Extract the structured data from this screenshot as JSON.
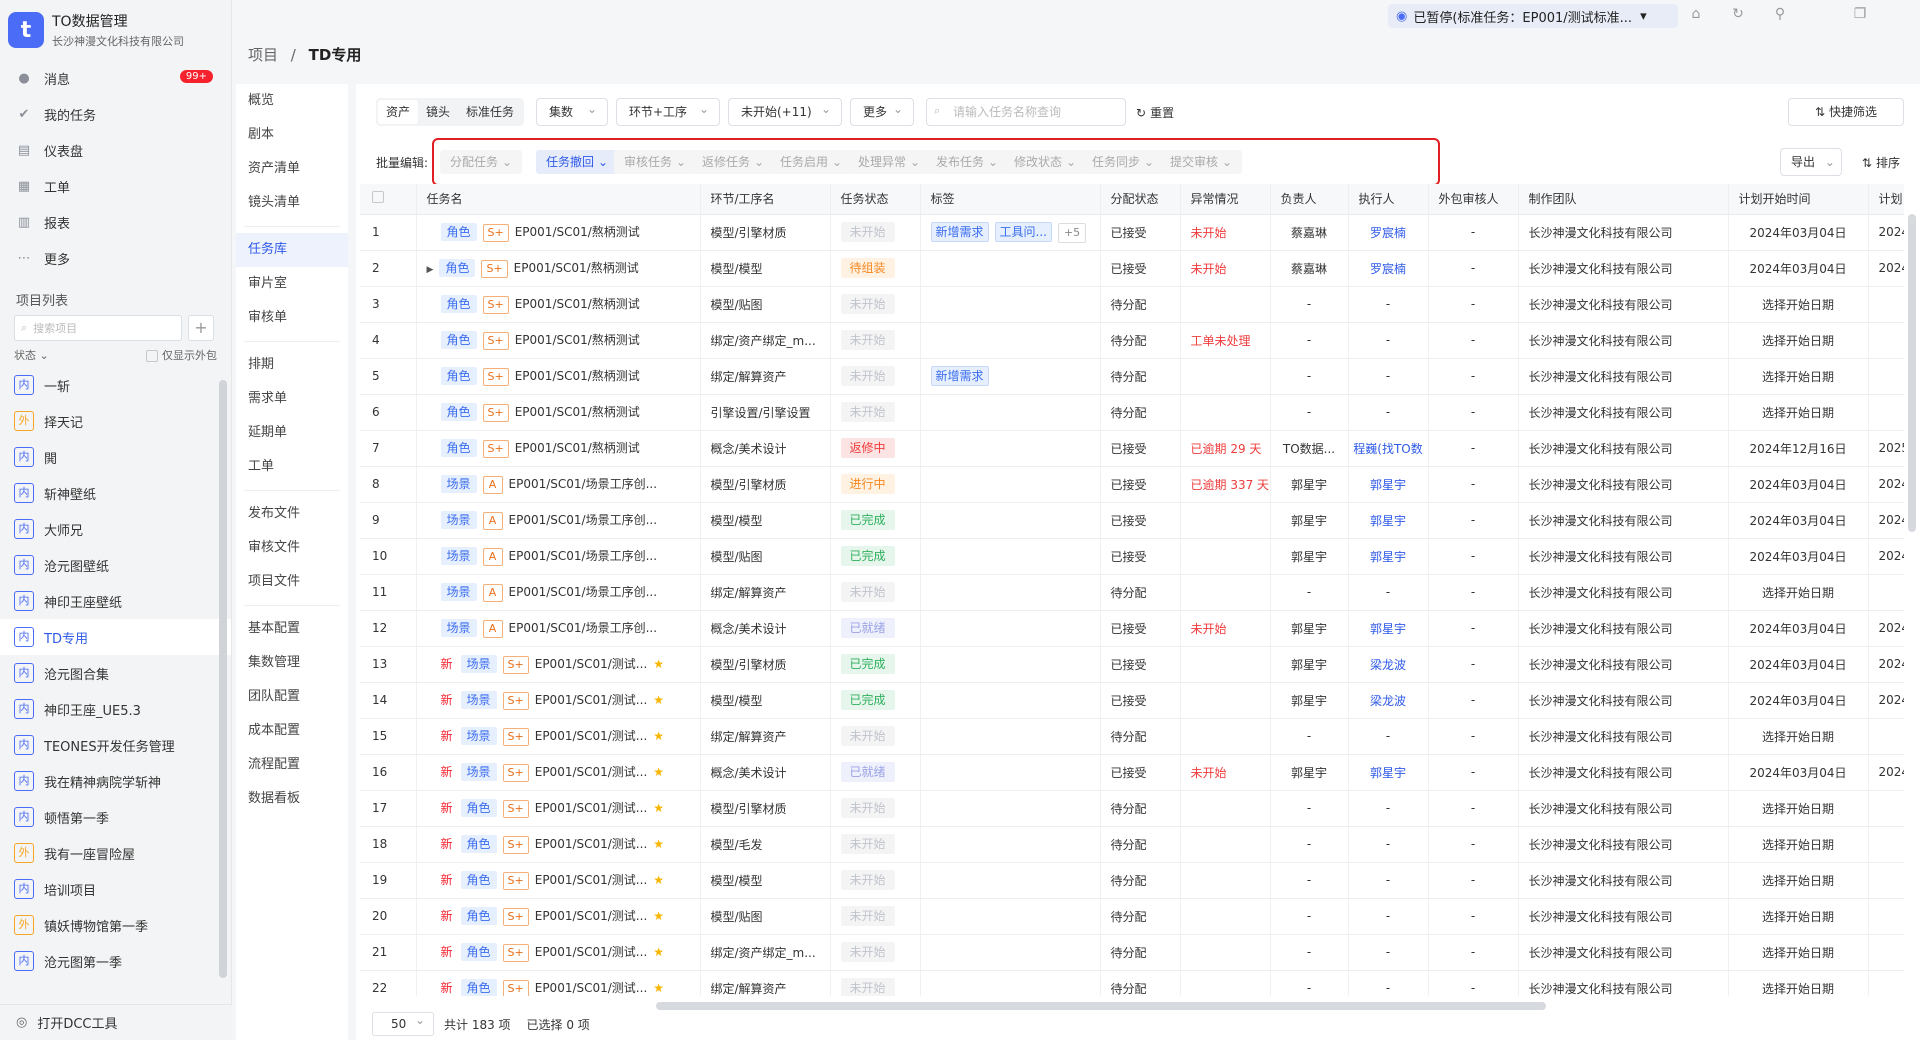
{
  "app": {
    "title": "TO数据管理",
    "company": "长沙神漫文化科技有限公司",
    "logo_letter": "t"
  },
  "nav": [
    {
      "label": "消息",
      "icon": "chat-icon",
      "badge": "99+"
    },
    {
      "label": "我的任务",
      "icon": "check-icon"
    },
    {
      "label": "仪表盘",
      "icon": "dashboard-icon"
    },
    {
      "label": "工单",
      "icon": "ticket-icon"
    },
    {
      "label": "报表",
      "icon": "report-icon"
    },
    {
      "label": "更多",
      "icon": "more-icon"
    }
  ],
  "projects": {
    "heading": "项目列表",
    "search_placeholder": "搜索项目",
    "add_label": "+",
    "filter_label": "状态",
    "only_outsourced_label": "仅显示外包",
    "items": [
      {
        "tag": "内",
        "name": "一斩"
      },
      {
        "tag": "外",
        "name": "择天记"
      },
      {
        "tag": "内",
        "name": "閧"
      },
      {
        "tag": "内",
        "name": "斩神壁纸"
      },
      {
        "tag": "内",
        "name": "大师兄"
      },
      {
        "tag": "内",
        "name": "沧元图壁纸"
      },
      {
        "tag": "内",
        "name": "神印王座壁纸"
      },
      {
        "tag": "内",
        "name": "TD专用"
      },
      {
        "tag": "内",
        "name": "沧元图合集"
      },
      {
        "tag": "内",
        "name": "神印王座_UE5.3"
      },
      {
        "tag": "内",
        "name": "TEONES开发任务管理"
      },
      {
        "tag": "内",
        "name": "我在精神病院学斩神"
      },
      {
        "tag": "内",
        "name": "顿悟第一季"
      },
      {
        "tag": "外",
        "name": "我有一座冒险屋"
      },
      {
        "tag": "内",
        "name": "培训项目"
      },
      {
        "tag": "外",
        "name": "镇妖博物馆第一季"
      },
      {
        "tag": "内",
        "name": "沧元图第一季"
      }
    ],
    "active_index": 7
  },
  "dcc_label": "打开DCC工具",
  "topbar": {
    "paused_text": "已暂停(标准任务：EP001/测试标准...",
    "icons": [
      "camera-icon",
      "refresh-icon",
      "pin-icon",
      "window-icon"
    ]
  },
  "breadcrumb": {
    "root": "项目",
    "sep": "/",
    "current": "TD专用"
  },
  "subnav": {
    "groups": [
      [
        "概览",
        "剧本",
        "资产清单",
        "镜头清单"
      ],
      [
        "任务库",
        "审片室",
        "审核单"
      ],
      [
        "排期",
        "需求单",
        "延期单",
        "工单"
      ],
      [
        "发布文件",
        "审核文件",
        "项目文件"
      ],
      [
        "基本配置",
        "集数管理",
        "团队配置",
        "成本配置",
        "流程配置",
        "数据看板"
      ]
    ],
    "active": "任务库"
  },
  "toolbar": {
    "segments": [
      "资产",
      "镜头",
      "标准任务"
    ],
    "dropdowns": [
      "集数",
      "环节+工序",
      "未开始(+11)",
      "更多"
    ],
    "search_placeholder": "请输入任务名称查询",
    "reset_label": "重置",
    "quick_filter_label": "快捷筛选"
  },
  "batch": {
    "label": "批量编辑:",
    "buttons": [
      "分配任务",
      "任务撤回",
      "审核任务",
      "返修任务",
      "任务启用",
      "处理异常",
      "发布任务",
      "修改状态",
      "任务同步",
      "提交审核"
    ],
    "active_index": 1,
    "export_label": "导出",
    "sort_label": "排序"
  },
  "table": {
    "columns": [
      "任务名",
      "环节/工序名",
      "任务状态",
      "标签",
      "分配状态",
      "异常情况",
      "负责人",
      "执行人",
      "外包审核人",
      "制作团队",
      "计划开始时间",
      "计划"
    ],
    "rows": [
      {
        "idx": "1",
        "new": false,
        "expand": false,
        "kind": "角色",
        "grade": "S+",
        "name": "EP001/SC01/熬柄测试",
        "star": false,
        "step": "模型/引擎材质",
        "status": "未开始",
        "status_color": "gray",
        "labels": [
          "新增需求",
          "工具问..."
        ],
        "more": "+5",
        "assign": "已接受",
        "anomaly": "未开始",
        "owner": "蔡嘉琳",
        "exec": "罗宸楠",
        "reviewer": "-",
        "team": "长沙神漫文化科技有限公司",
        "start": "2024年03月04日",
        "end": "2024"
      },
      {
        "idx": "2",
        "new": false,
        "expand": true,
        "kind": "角色",
        "grade": "S+",
        "name": "EP001/SC01/熬柄测试",
        "star": false,
        "step": "模型/模型",
        "status": "待组装",
        "status_color": "orange",
        "labels": [],
        "more": "",
        "assign": "已接受",
        "anomaly": "未开始",
        "owner": "蔡嘉琳",
        "exec": "罗宸楠",
        "reviewer": "-",
        "team": "长沙神漫文化科技有限公司",
        "start": "2024年03月04日",
        "end": "2024"
      },
      {
        "idx": "3",
        "new": false,
        "expand": false,
        "kind": "角色",
        "grade": "S+",
        "name": "EP001/SC01/熬柄测试",
        "star": false,
        "step": "模型/贴图",
        "status": "未开始",
        "status_color": "gray",
        "labels": [],
        "more": "",
        "assign": "待分配",
        "anomaly": "",
        "owner": "-",
        "exec": "-",
        "reviewer": "-",
        "team": "长沙神漫文化科技有限公司",
        "start": "选择开始日期",
        "end": ""
      },
      {
        "idx": "4",
        "new": false,
        "expand": false,
        "kind": "角色",
        "grade": "S+",
        "name": "EP001/SC01/熬柄测试",
        "star": false,
        "step": "绑定/资产绑定_m...",
        "status": "未开始",
        "status_color": "gray",
        "labels": [],
        "more": "",
        "assign": "待分配",
        "anomaly": "工单未处理",
        "owner": "-",
        "exec": "-",
        "reviewer": "-",
        "team": "长沙神漫文化科技有限公司",
        "start": "选择开始日期",
        "end": ""
      },
      {
        "idx": "5",
        "new": false,
        "expand": false,
        "kind": "角色",
        "grade": "S+",
        "name": "EP001/SC01/熬柄测试",
        "star": false,
        "step": "绑定/解算资产",
        "status": "未开始",
        "status_color": "gray",
        "labels": [
          "新增需求"
        ],
        "more": "",
        "assign": "待分配",
        "anomaly": "",
        "owner": "-",
        "exec": "-",
        "reviewer": "-",
        "team": "长沙神漫文化科技有限公司",
        "start": "选择开始日期",
        "end": ""
      },
      {
        "idx": "6",
        "new": false,
        "expand": false,
        "kind": "角色",
        "grade": "S+",
        "name": "EP001/SC01/熬柄测试",
        "star": false,
        "step": "引擎设置/引擎设置",
        "status": "未开始",
        "status_color": "gray",
        "labels": [],
        "more": "",
        "assign": "待分配",
        "anomaly": "",
        "owner": "-",
        "exec": "-",
        "reviewer": "-",
        "team": "长沙神漫文化科技有限公司",
        "start": "选择开始日期",
        "end": ""
      },
      {
        "idx": "7",
        "new": false,
        "expand": false,
        "kind": "角色",
        "grade": "S+",
        "name": "EP001/SC01/熬柄测试",
        "star": false,
        "step": "概念/美术设计",
        "status": "返修中",
        "status_color": "red",
        "labels": [],
        "more": "",
        "assign": "已接受",
        "anomaly": "已逾期 29 天",
        "owner": "TO数据...",
        "exec": "程巍(找TO数",
        "reviewer": "-",
        "team": "长沙神漫文化科技有限公司",
        "start": "2024年12月16日",
        "end": "2025"
      },
      {
        "idx": "8",
        "new": false,
        "expand": false,
        "kind": "场景",
        "grade": "A",
        "name": "EP001/SC01/场景工序创...",
        "star": false,
        "step": "模型/引擎材质",
        "status": "进行中",
        "status_color": "orange",
        "labels": [],
        "more": "",
        "assign": "已接受",
        "anomaly": "已逾期 337 天",
        "owner": "郭星宇",
        "exec": "郭星宇",
        "reviewer": "-",
        "team": "长沙神漫文化科技有限公司",
        "start": "2024年03月04日",
        "end": "2024"
      },
      {
        "idx": "9",
        "new": false,
        "expand": false,
        "kind": "场景",
        "grade": "A",
        "name": "EP001/SC01/场景工序创...",
        "star": false,
        "step": "模型/模型",
        "status": "已完成",
        "status_color": "green",
        "labels": [],
        "more": "",
        "assign": "已接受",
        "anomaly": "",
        "owner": "郭星宇",
        "exec": "郭星宇",
        "reviewer": "-",
        "team": "长沙神漫文化科技有限公司",
        "start": "2024年03月04日",
        "end": "2024"
      },
      {
        "idx": "10",
        "new": false,
        "expand": false,
        "kind": "场景",
        "grade": "A",
        "name": "EP001/SC01/场景工序创...",
        "star": false,
        "step": "模型/贴图",
        "status": "已完成",
        "status_color": "green",
        "labels": [],
        "more": "",
        "assign": "已接受",
        "anomaly": "",
        "owner": "郭星宇",
        "exec": "郭星宇",
        "reviewer": "-",
        "team": "长沙神漫文化科技有限公司",
        "start": "2024年03月04日",
        "end": "2024"
      },
      {
        "idx": "11",
        "new": false,
        "expand": false,
        "kind": "场景",
        "grade": "A",
        "name": "EP001/SC01/场景工序创...",
        "star": false,
        "step": "绑定/解算资产",
        "status": "未开始",
        "status_color": "gray",
        "labels": [],
        "more": "",
        "assign": "待分配",
        "anomaly": "",
        "owner": "-",
        "exec": "-",
        "reviewer": "-",
        "team": "长沙神漫文化科技有限公司",
        "start": "选择开始日期",
        "end": ""
      },
      {
        "idx": "12",
        "new": false,
        "expand": false,
        "kind": "场景",
        "grade": "A",
        "name": "EP001/SC01/场景工序创...",
        "star": false,
        "step": "概念/美术设计",
        "status": "已就绪",
        "status_color": "lav",
        "labels": [],
        "more": "",
        "assign": "已接受",
        "anomaly": "未开始",
        "owner": "郭星宇",
        "exec": "郭星宇",
        "reviewer": "-",
        "team": "长沙神漫文化科技有限公司",
        "start": "2024年03月04日",
        "end": "2024"
      },
      {
        "idx": "13",
        "new": true,
        "expand": false,
        "kind": "场景",
        "grade": "S+",
        "name": "EP001/SC01/测试...",
        "star": true,
        "step": "模型/引擎材质",
        "status": "已完成",
        "status_color": "green",
        "labels": [],
        "more": "",
        "assign": "已接受",
        "anomaly": "",
        "owner": "郭星宇",
        "exec": "梁龙波",
        "reviewer": "-",
        "team": "长沙神漫文化科技有限公司",
        "start": "2024年03月04日",
        "end": "2024"
      },
      {
        "idx": "14",
        "new": true,
        "expand": false,
        "kind": "场景",
        "grade": "S+",
        "name": "EP001/SC01/测试...",
        "star": true,
        "step": "模型/模型",
        "status": "已完成",
        "status_color": "green",
        "labels": [],
        "more": "",
        "assign": "已接受",
        "anomaly": "",
        "owner": "郭星宇",
        "exec": "梁龙波",
        "reviewer": "-",
        "team": "长沙神漫文化科技有限公司",
        "start": "2024年03月04日",
        "end": "2024"
      },
      {
        "idx": "15",
        "new": true,
        "expand": false,
        "kind": "场景",
        "grade": "S+",
        "name": "EP001/SC01/测试...",
        "star": true,
        "step": "绑定/解算资产",
        "status": "未开始",
        "status_color": "gray",
        "labels": [],
        "more": "",
        "assign": "待分配",
        "anomaly": "",
        "owner": "-",
        "exec": "-",
        "reviewer": "-",
        "team": "长沙神漫文化科技有限公司",
        "start": "选择开始日期",
        "end": ""
      },
      {
        "idx": "16",
        "new": true,
        "expand": false,
        "kind": "场景",
        "grade": "S+",
        "name": "EP001/SC01/测试...",
        "star": true,
        "step": "概念/美术设计",
        "status": "已就绪",
        "status_color": "lav",
        "labels": [],
        "more": "",
        "assign": "已接受",
        "anomaly": "未开始",
        "owner": "郭星宇",
        "exec": "郭星宇",
        "reviewer": "-",
        "team": "长沙神漫文化科技有限公司",
        "start": "2024年03月04日",
        "end": "2024"
      },
      {
        "idx": "17",
        "new": true,
        "expand": false,
        "kind": "角色",
        "grade": "S+",
        "name": "EP001/SC01/测试...",
        "star": true,
        "step": "模型/引擎材质",
        "status": "未开始",
        "status_color": "gray",
        "labels": [],
        "more": "",
        "assign": "待分配",
        "anomaly": "",
        "owner": "-",
        "exec": "-",
        "reviewer": "-",
        "team": "长沙神漫文化科技有限公司",
        "start": "选择开始日期",
        "end": ""
      },
      {
        "idx": "18",
        "new": true,
        "expand": false,
        "kind": "角色",
        "grade": "S+",
        "name": "EP001/SC01/测试...",
        "star": true,
        "step": "模型/毛发",
        "status": "未开始",
        "status_color": "gray",
        "labels": [],
        "more": "",
        "assign": "待分配",
        "anomaly": "",
        "owner": "-",
        "exec": "-",
        "reviewer": "-",
        "team": "长沙神漫文化科技有限公司",
        "start": "选择开始日期",
        "end": ""
      },
      {
        "idx": "19",
        "new": true,
        "expand": false,
        "kind": "角色",
        "grade": "S+",
        "name": "EP001/SC01/测试...",
        "star": true,
        "step": "模型/模型",
        "status": "未开始",
        "status_color": "gray",
        "labels": [],
        "more": "",
        "assign": "待分配",
        "anomaly": "",
        "owner": "-",
        "exec": "-",
        "reviewer": "-",
        "team": "长沙神漫文化科技有限公司",
        "start": "选择开始日期",
        "end": ""
      },
      {
        "idx": "20",
        "new": true,
        "expand": false,
        "kind": "角色",
        "grade": "S+",
        "name": "EP001/SC01/测试...",
        "star": true,
        "step": "模型/贴图",
        "status": "未开始",
        "status_color": "gray",
        "labels": [],
        "more": "",
        "assign": "待分配",
        "anomaly": "",
        "owner": "-",
        "exec": "-",
        "reviewer": "-",
        "team": "长沙神漫文化科技有限公司",
        "start": "选择开始日期",
        "end": ""
      },
      {
        "idx": "21",
        "new": true,
        "expand": false,
        "kind": "角色",
        "grade": "S+",
        "name": "EP001/SC01/测试...",
        "star": true,
        "step": "绑定/资产绑定_m...",
        "status": "未开始",
        "status_color": "gray",
        "labels": [],
        "more": "",
        "assign": "待分配",
        "anomaly": "",
        "owner": "-",
        "exec": "-",
        "reviewer": "-",
        "team": "长沙神漫文化科技有限公司",
        "start": "选择开始日期",
        "end": ""
      },
      {
        "idx": "22",
        "new": true,
        "expand": false,
        "kind": "角色",
        "grade": "S+",
        "name": "EP001/SC01/测试...",
        "star": true,
        "step": "绑定/解算资产",
        "status": "未开始",
        "status_color": "gray",
        "labels": [],
        "more": "",
        "assign": "待分配",
        "anomaly": "",
        "owner": "-",
        "exec": "-",
        "reviewer": "-",
        "team": "长沙神漫文化科技有限公司",
        "start": "选择开始日期",
        "end": ""
      }
    ]
  },
  "footer": {
    "page_size": "50",
    "total": "共计 183 项",
    "selected": "已选择 0 项"
  }
}
